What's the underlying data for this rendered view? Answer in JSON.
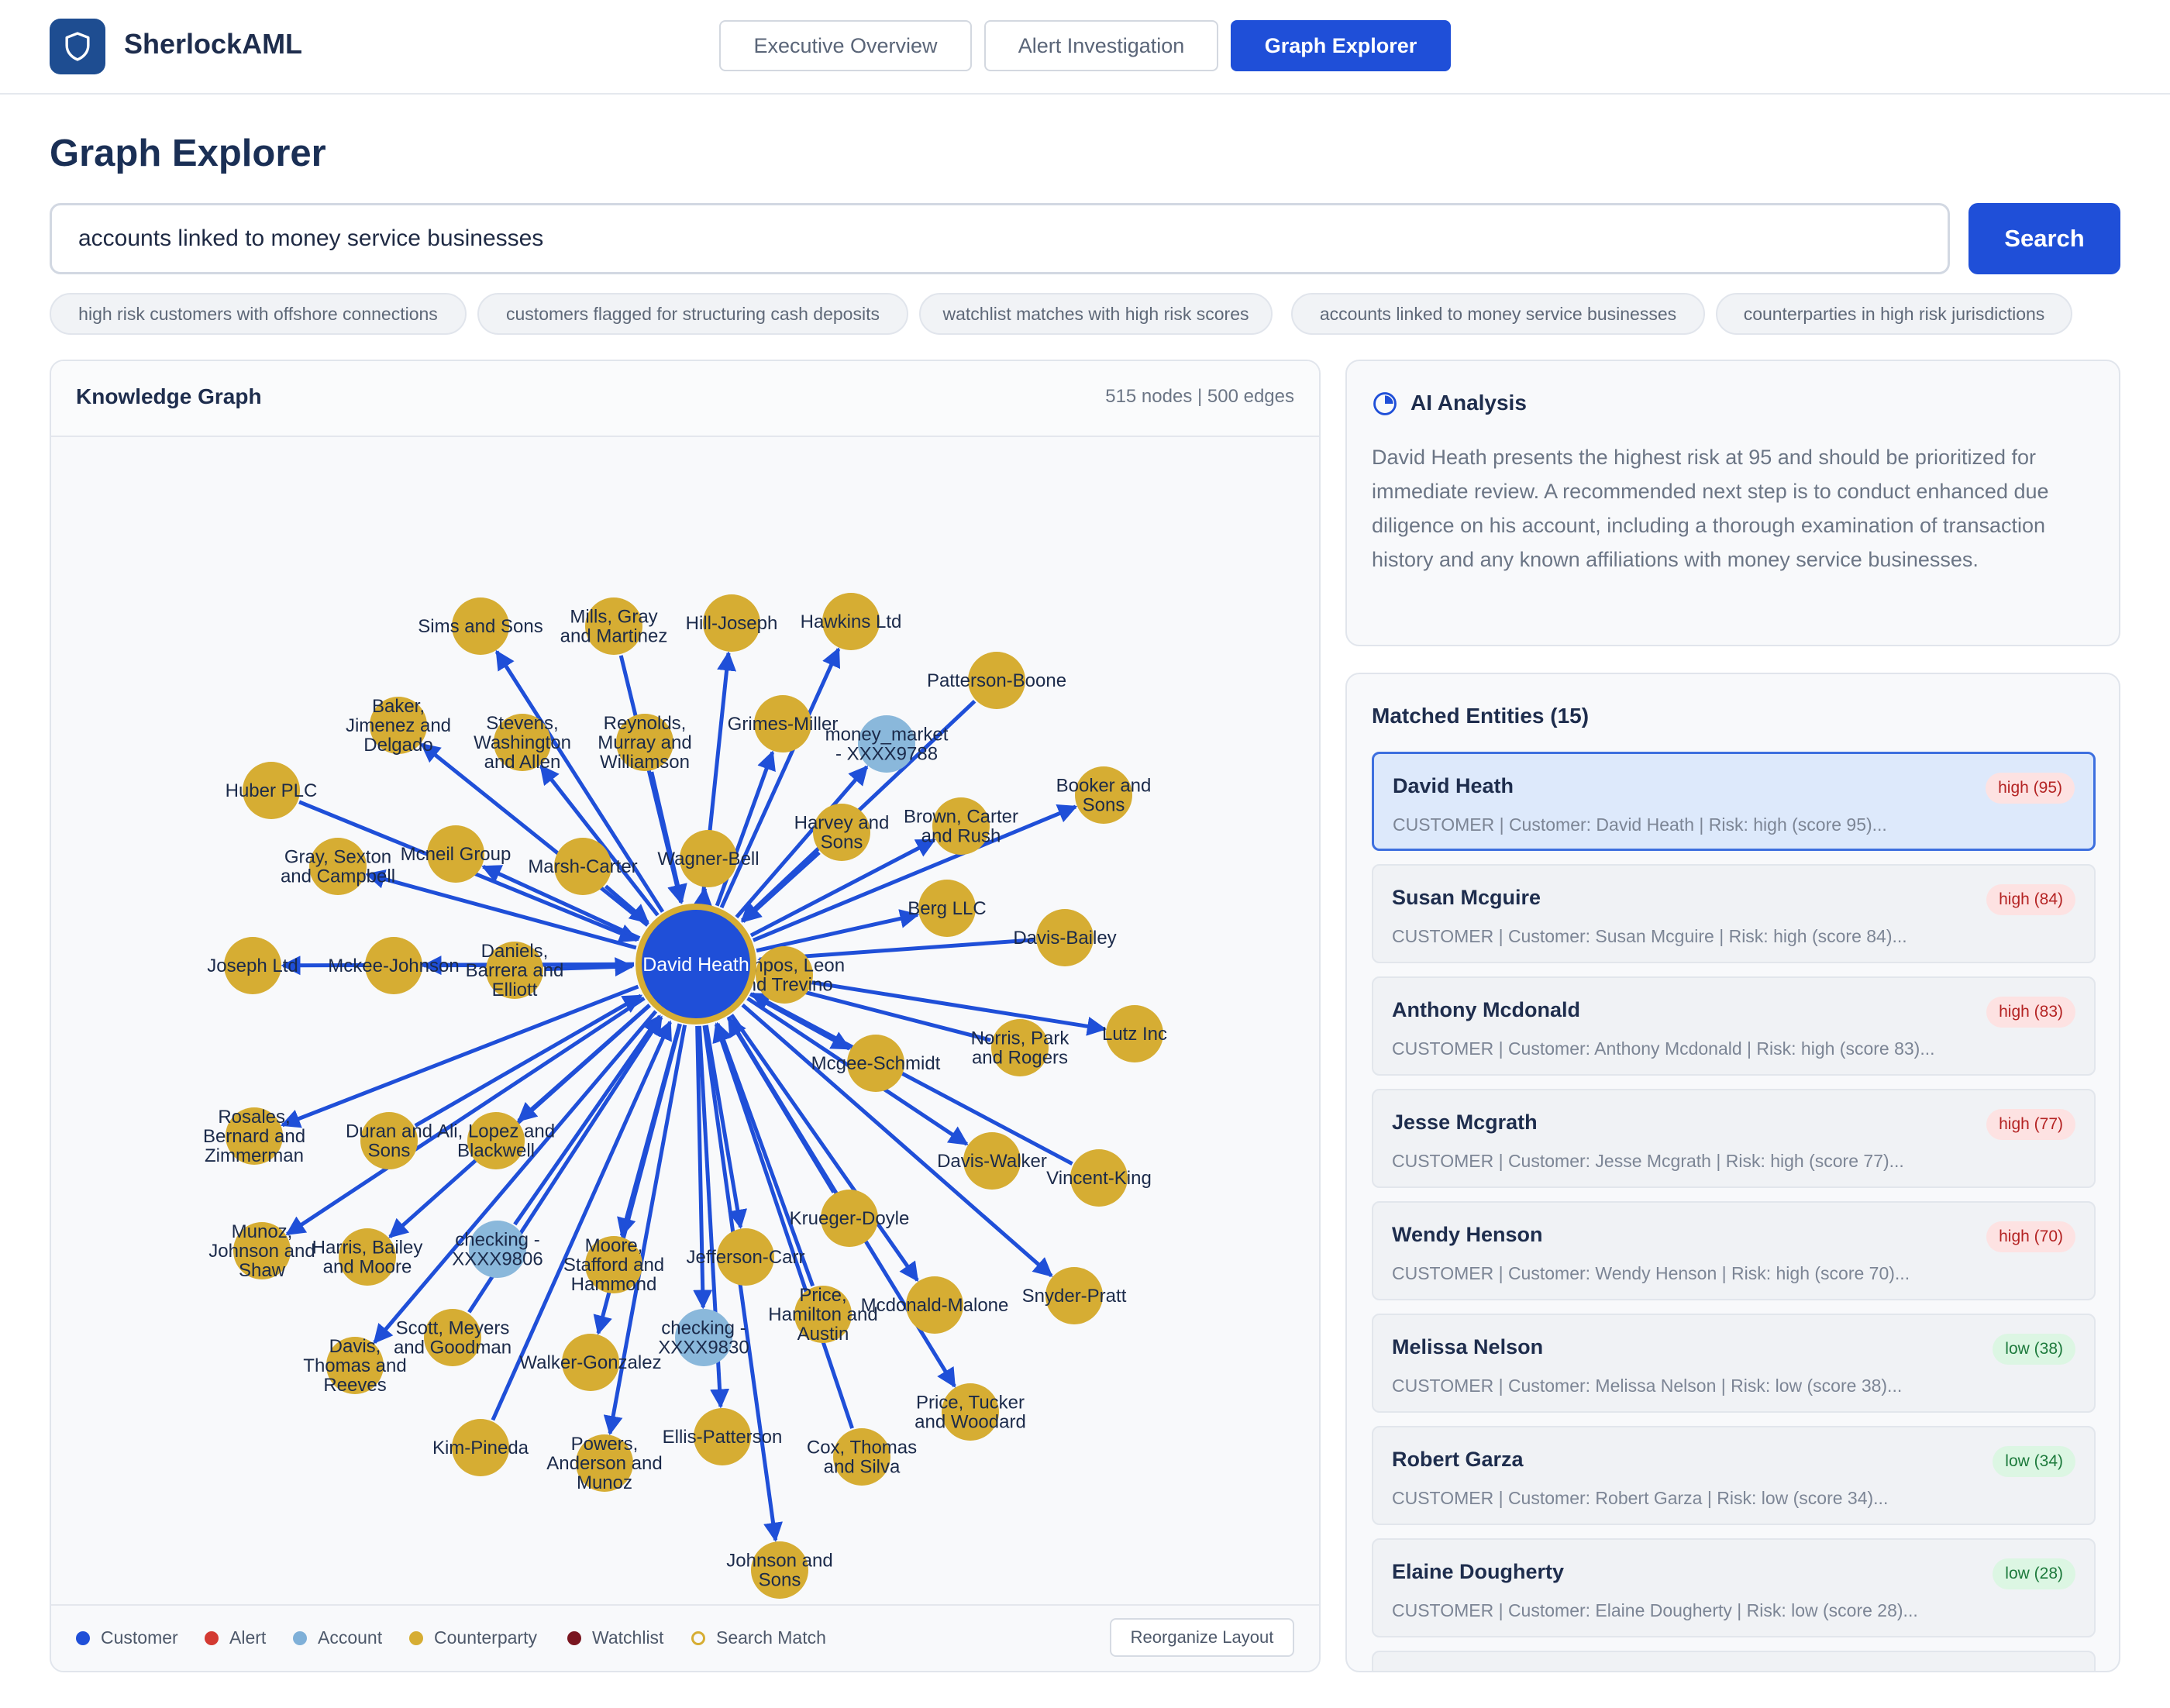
{
  "app": {
    "name": "SherlockAML"
  },
  "nav": {
    "tabs": [
      {
        "label": "Executive Overview",
        "active": false
      },
      {
        "label": "Alert Investigation",
        "active": false
      },
      {
        "label": "Graph Explorer",
        "active": true
      }
    ]
  },
  "page": {
    "title": "Graph Explorer"
  },
  "search": {
    "value": "accounts linked to money service businesses",
    "button_label": "Search"
  },
  "suggestions": [
    "high risk customers with offshore connections",
    "customers flagged for structuring cash deposits",
    "watchlist matches with high risk scores",
    "accounts linked to money service businesses",
    "counterparties in high risk jurisdictions"
  ],
  "graph": {
    "title": "Knowledge Graph",
    "stats": "515 nodes | 500 edges",
    "center": "David Heath",
    "nodes": [
      {
        "label": "Sims and Sons",
        "type": "counterparty"
      },
      {
        "label": "Mills, Gray\nand Martinez",
        "type": "counterparty"
      },
      {
        "label": "Hill-Joseph",
        "type": "counterparty"
      },
      {
        "label": "Hawkins Ltd",
        "type": "counterparty"
      },
      {
        "label": "Patterson-Boone",
        "type": "counterparty"
      },
      {
        "label": "Baker,\nJimenez and\nDelgado",
        "type": "counterparty"
      },
      {
        "label": "Stevens,\nWashington\nand Allen",
        "type": "counterparty"
      },
      {
        "label": "Reynolds,\nMurray and\nWilliamson",
        "type": "counterparty"
      },
      {
        "label": "Grimes-Miller",
        "type": "counterparty"
      },
      {
        "label": "money_market\n- XXXX9788",
        "type": "account"
      },
      {
        "label": "Huber PLC",
        "type": "counterparty"
      },
      {
        "label": "Booker and\nSons",
        "type": "counterparty"
      },
      {
        "label": "Brown, Carter\nand Rush",
        "type": "counterparty"
      },
      {
        "label": "Harvey and\nSons",
        "type": "counterparty"
      },
      {
        "label": "Gray, Sexton\nand Campbell",
        "type": "counterparty"
      },
      {
        "label": "Mcneil Group",
        "type": "counterparty"
      },
      {
        "label": "Marsh-Carter",
        "type": "counterparty"
      },
      {
        "label": "Wagner-Bell",
        "type": "counterparty"
      },
      {
        "label": "Berg LLC",
        "type": "counterparty"
      },
      {
        "label": "Davis-Bailey",
        "type": "counterparty"
      },
      {
        "label": "Joseph Ltd",
        "type": "counterparty"
      },
      {
        "label": "Mckee-Johnson",
        "type": "counterparty"
      },
      {
        "label": "Daniels,\nBarrera and\nElliott",
        "type": "counterparty"
      },
      {
        "label": "Campos, Leon\nand Trevino",
        "type": "counterparty"
      },
      {
        "label": "Lutz Inc",
        "type": "counterparty"
      },
      {
        "label": "Norris, Park\nand Rogers",
        "type": "counterparty"
      },
      {
        "label": "Mcgee-Schmidt",
        "type": "counterparty"
      },
      {
        "label": "Rosales,\nBernard and\nZimmerman",
        "type": "counterparty"
      },
      {
        "label": "Duran and\nSons",
        "type": "counterparty"
      },
      {
        "label": "Ali, Lopez and\nBlackwell",
        "type": "counterparty"
      },
      {
        "label": "Davis-Walker",
        "type": "counterparty"
      },
      {
        "label": "Vincent-King",
        "type": "counterparty"
      },
      {
        "label": "Munoz,\nJohnson and\nShaw",
        "type": "counterparty"
      },
      {
        "label": "Harris, Bailey\nand Moore",
        "type": "counterparty"
      },
      {
        "label": "checking -\nXXXX9806",
        "type": "account"
      },
      {
        "label": "Moore,\nStafford and\nHammond",
        "type": "counterparty"
      },
      {
        "label": "Jefferson-Carr",
        "type": "counterparty"
      },
      {
        "label": "Krueger-Doyle",
        "type": "counterparty"
      },
      {
        "label": "Snyder-Pratt",
        "type": "counterparty"
      },
      {
        "label": "Davis,\nThomas and\nReeves",
        "type": "counterparty"
      },
      {
        "label": "Scott, Meyers\nand Goodman",
        "type": "counterparty"
      },
      {
        "label": "Walker-Gonzalez",
        "type": "counterparty"
      },
      {
        "label": "checking -\nXXXX9830",
        "type": "account"
      },
      {
        "label": "Price,\nHamilton and\nAustin",
        "type": "counterparty"
      },
      {
        "label": "Mcdonald-Malone",
        "type": "counterparty"
      },
      {
        "label": "Price, Tucker\nand Woodard",
        "type": "counterparty"
      },
      {
        "label": "Kim-Pineda",
        "type": "counterparty"
      },
      {
        "label": "Powers,\nAnderson and\nMunoz",
        "type": "counterparty"
      },
      {
        "label": "Ellis-Patterson",
        "type": "counterparty"
      },
      {
        "label": "Cox, Thomas\nand Silva",
        "type": "counterparty"
      },
      {
        "label": "Johnson and\nSons",
        "type": "counterparty"
      }
    ],
    "legend": [
      {
        "label": "Customer",
        "color": "#1f4fd8"
      },
      {
        "label": "Alert",
        "color": "#d33a32"
      },
      {
        "label": "Account",
        "color": "#7fb0d8"
      },
      {
        "label": "Counterparty",
        "color": "#d6ad33"
      },
      {
        "label": "Watchlist",
        "color": "#7a1620"
      },
      {
        "label": "Search Match",
        "color": "#d6ad33"
      }
    ],
    "reorganize_label": "Reorganize Layout"
  },
  "ai_analysis": {
    "title": "AI Analysis",
    "text": "David Heath presents the highest risk at 95 and should be prioritized for immediate review. A recommended next step is to conduct enhanced due diligence on his account, including a thorough examination of transaction history and any known affiliations with money service businesses."
  },
  "matched": {
    "title": "Matched Entities (15)",
    "entities": [
      {
        "name": "David Heath",
        "badge": "high (95)",
        "level": "high",
        "sub": "CUSTOMER | Customer: David Heath | Risk: high (score 95)...",
        "selected": true
      },
      {
        "name": "Susan Mcguire",
        "badge": "high (84)",
        "level": "high",
        "sub": "CUSTOMER | Customer: Susan Mcguire | Risk: high (score 84)..."
      },
      {
        "name": "Anthony Mcdonald",
        "badge": "high (83)",
        "level": "high",
        "sub": "CUSTOMER | Customer: Anthony Mcdonald | Risk: high (score 83)..."
      },
      {
        "name": "Jesse Mcgrath",
        "badge": "high (77)",
        "level": "high",
        "sub": "CUSTOMER | Customer: Jesse Mcgrath | Risk: high (score 77)..."
      },
      {
        "name": "Wendy Henson",
        "badge": "high (70)",
        "level": "high",
        "sub": "CUSTOMER | Customer: Wendy Henson | Risk: high (score 70)..."
      },
      {
        "name": "Melissa Nelson",
        "badge": "low (38)",
        "level": "low",
        "sub": "CUSTOMER | Customer: Melissa Nelson | Risk: low (score 38)..."
      },
      {
        "name": "Robert Garza",
        "badge": "low (34)",
        "level": "low",
        "sub": "CUSTOMER | Customer: Robert Garza | Risk: low (score 34)..."
      },
      {
        "name": "Elaine Dougherty",
        "badge": "low (28)",
        "level": "low",
        "sub": "CUSTOMER | Customer: Elaine Dougherty | Risk: low (score 28)..."
      }
    ]
  }
}
